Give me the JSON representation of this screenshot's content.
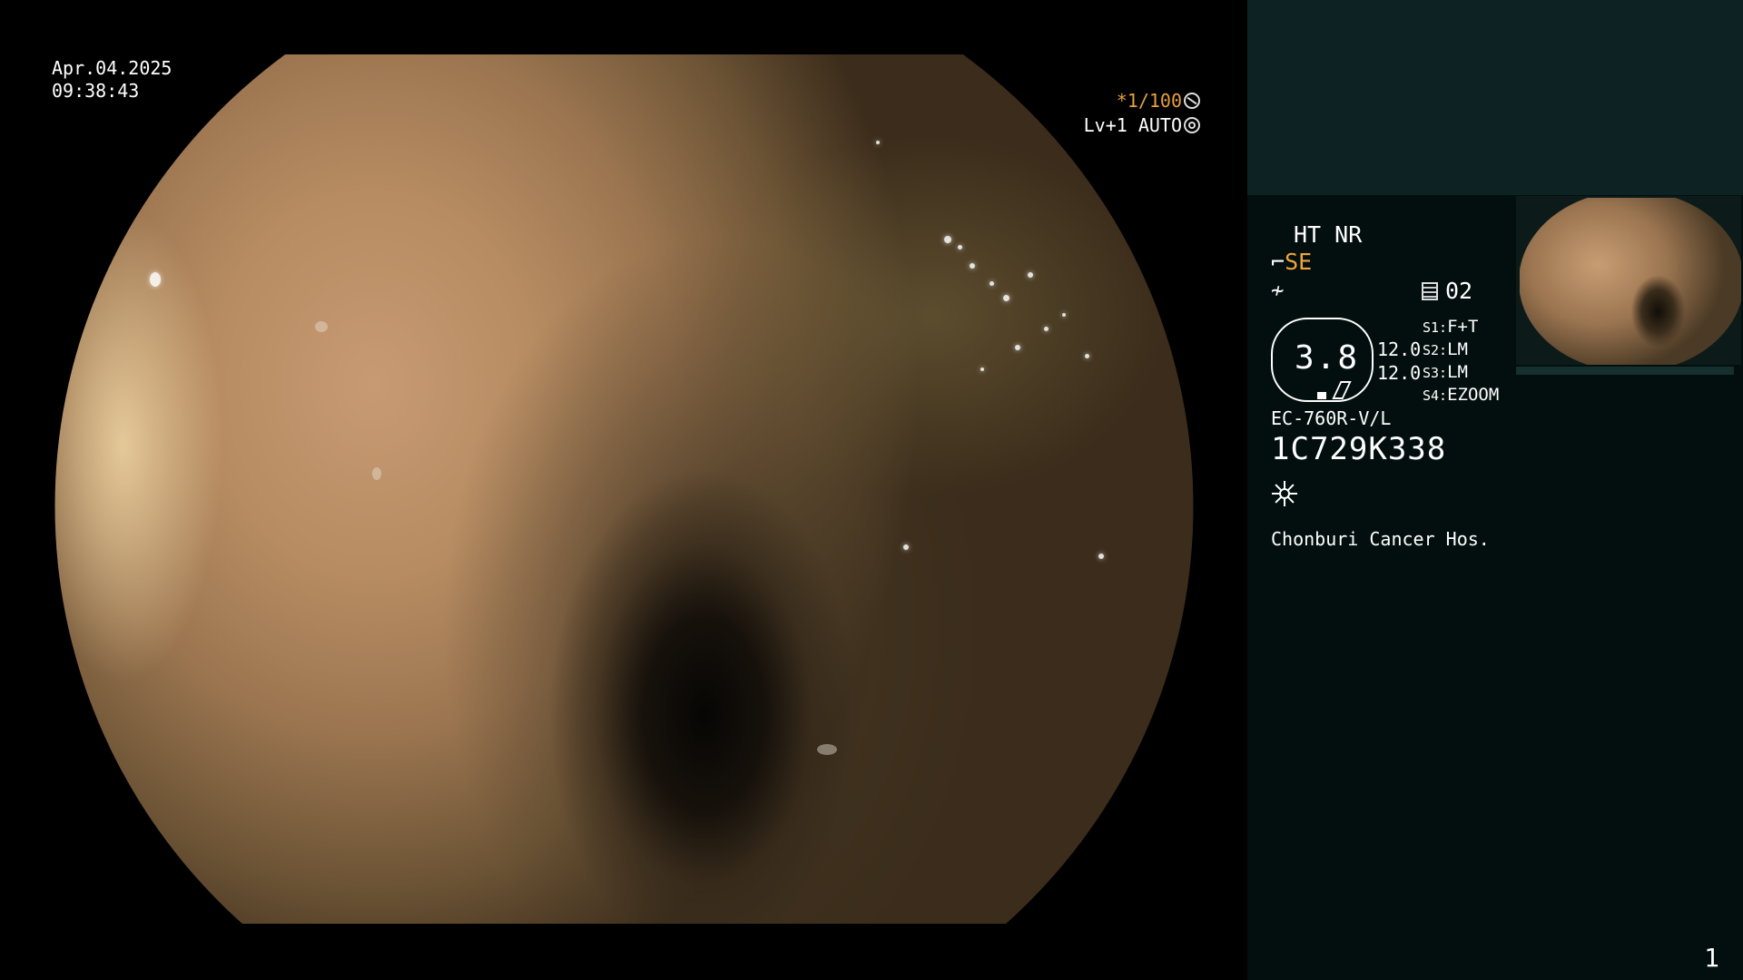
{
  "overlay": {
    "date": "Apr.04.2025",
    "time": "09:38:43",
    "shutter_speed": "*1/100",
    "shutter_icon": "shutter-icon",
    "level_auto": "Lv+1 AUTO",
    "iris_icon": "iris-icon"
  },
  "panel": {
    "ht_nr": "HT NR",
    "structure_enhancement": "SE",
    "structure_icon": "structure-enhancement-icon",
    "color_enhancement_icon": "color-enhancement-icon",
    "memory_count": "02",
    "memory_icon": "memory-card-icon",
    "zoom_value": "3.8",
    "value_a": "12.0",
    "value_b": "12.0",
    "switches": [
      {
        "label": "S1:",
        "value": "F+T"
      },
      {
        "label": "S2:",
        "value": "LM"
      },
      {
        "label": "S3:",
        "value": "LM"
      },
      {
        "label": "S4:",
        "value": "EZOOM"
      }
    ],
    "scope_model": "EC-760R-V/L",
    "serial_number": "1C729K338",
    "light_icon": "light-source-icon",
    "hospital": "Chonburi Cancer Hos."
  },
  "page_number": "1"
}
